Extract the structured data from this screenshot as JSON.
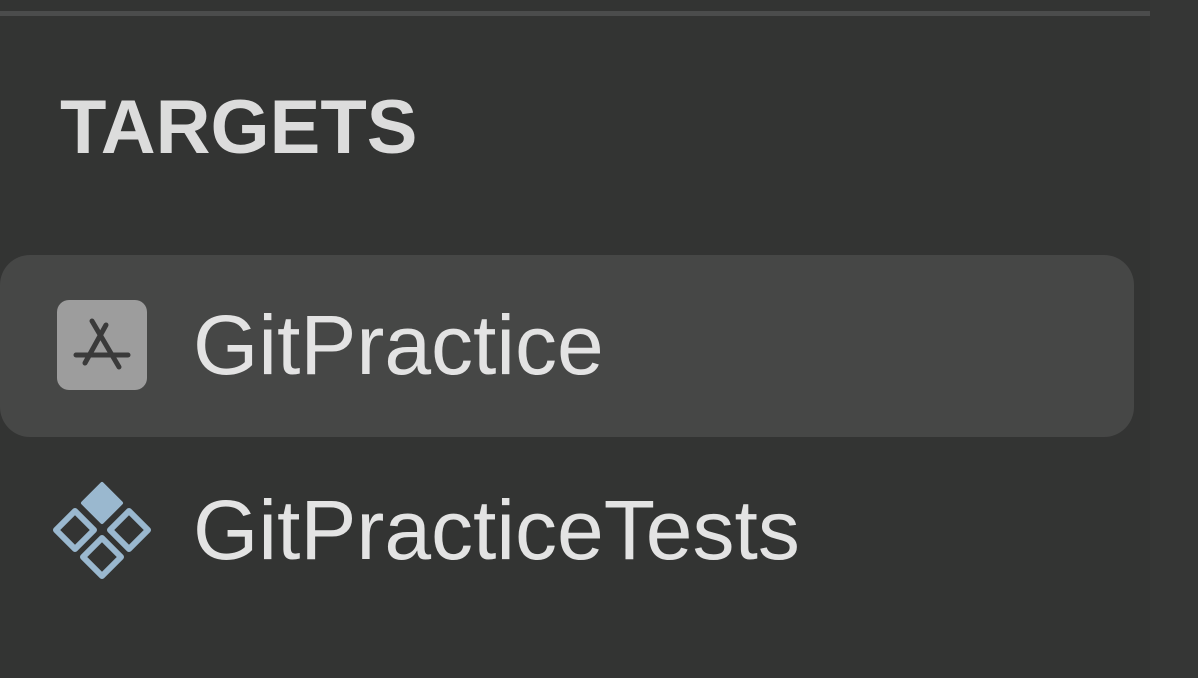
{
  "section": {
    "title": "TARGETS"
  },
  "targets": [
    {
      "label": "GitPractice",
      "icon": "app-store-icon",
      "selected": true
    },
    {
      "label": "GitPracticeTests",
      "icon": "unit-test-bundle-icon",
      "selected": false
    }
  ],
  "colors": {
    "background": "#333433",
    "selection": "#464746",
    "text": "#e3e3e3",
    "header_text": "#dcdcdc",
    "app_icon_bg": "#9d9d9d",
    "test_icon": "#9ab8cf"
  }
}
